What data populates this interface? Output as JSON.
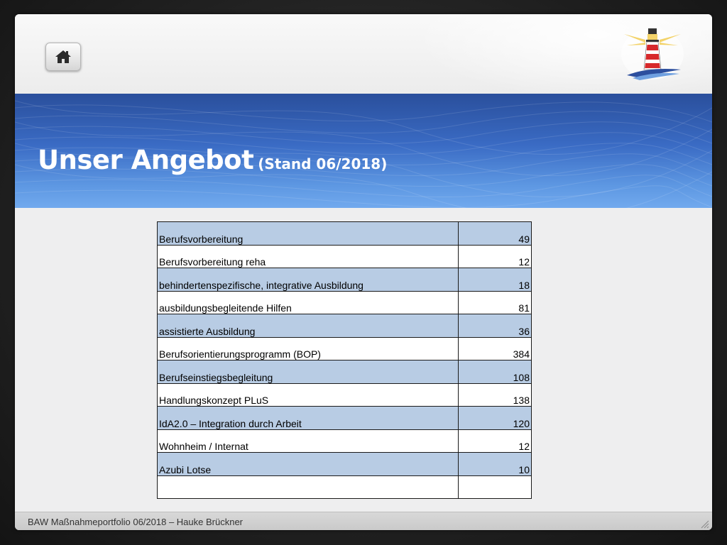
{
  "slide": {
    "title_main": "Unser Angebot",
    "title_sub": "(Stand 06/2018)",
    "footer": "BAW Maßnahmeportfolio 06/2018 – Hauke Brückner"
  },
  "icons": {
    "home": "home-icon",
    "logo": "lighthouse-logo",
    "grip": "resize-grip-icon"
  },
  "colors": {
    "band_top": "#2a4f9c",
    "band_bottom": "#71a9ee",
    "row_stripe": "#b8cce4"
  },
  "table": {
    "rows": [
      {
        "name": "Berufsvorbereitung",
        "count": "49"
      },
      {
        "name": "Berufsvorbereitung reha",
        "count": "12"
      },
      {
        "name": "behindertenspezifische, integrative Ausbildung",
        "count": "18"
      },
      {
        "name": "ausbildungsbegleitende Hilfen",
        "count": "81"
      },
      {
        "name": "assistierte Ausbildung",
        "count": "36"
      },
      {
        "name": "Berufsorientierungsprogramm (BOP)",
        "count": "384"
      },
      {
        "name": "Berufseinstiegsbegleitung",
        "count": "108"
      },
      {
        "name": "Handlungskonzept PLuS",
        "count": "138"
      },
      {
        "name": "IdA2.0 – Integration durch Arbeit",
        "count": "120"
      },
      {
        "name": "Wohnheim / Internat",
        "count": "12"
      },
      {
        "name": "Azubi Lotse",
        "count": "10"
      },
      {
        "name": "",
        "count": ""
      }
    ]
  }
}
